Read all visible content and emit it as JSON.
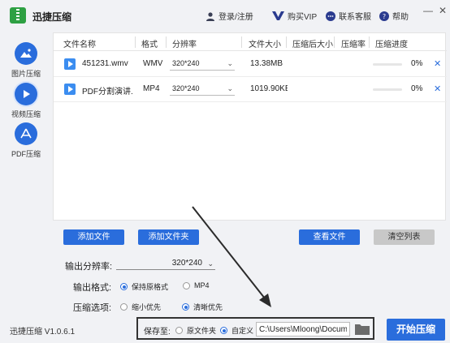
{
  "app": {
    "title": "迅捷压缩",
    "version": "迅捷压缩 V1.0.6.1"
  },
  "titlebar": {
    "login": "登录/注册",
    "vip": "购买VIP",
    "service": "联系客服",
    "help": "帮助",
    "min": "—",
    "close": "✕"
  },
  "sidebar": {
    "items": [
      {
        "label": "图片压缩",
        "icon": "image-icon"
      },
      {
        "label": "视频压缩",
        "icon": "play-icon"
      },
      {
        "label": "PDF压缩",
        "icon": "pdf-icon"
      }
    ]
  },
  "table": {
    "headers": [
      "文件名称",
      "格式",
      "分辨率",
      "文件大小",
      "压缩后大小",
      "压缩率",
      "压缩进度"
    ],
    "rows": [
      {
        "name": "451231.wmv",
        "format": "WMV",
        "resolution": "320*240",
        "size": "13.38MB",
        "after": "",
        "ratio": "",
        "progress": 0,
        "progress_text": "0%"
      },
      {
        "name": "PDF分割演讲...",
        "format": "MP4",
        "resolution": "320*240",
        "size": "1019.90KE",
        "after": "",
        "ratio": "",
        "progress": 0,
        "progress_text": "0%"
      }
    ]
  },
  "actions": {
    "add_file": "添加文件",
    "add_folder": "添加文件夹",
    "view_file": "查看文件",
    "clear_list": "清空列表"
  },
  "options": {
    "resolution_label": "输出分辨率:",
    "resolution_value": "320*240",
    "format_label": "输出格式:",
    "format_keep": "保持原格式",
    "format_mp4": "MP4",
    "format_selected": "keep",
    "compress_label": "压缩选项:",
    "compress_small": "缩小优先",
    "compress_clear": "清晰优先",
    "compress_selected": "clear"
  },
  "save": {
    "label": "保存至:",
    "original": "原文件夹",
    "custom": "自定义",
    "selected": "custom",
    "path": "C:\\Users\\Mloong\\Documents"
  },
  "start_button": "开始压缩",
  "colors": {
    "accent": "#2a6ddc",
    "disabled": "#c8c8c8",
    "background": "#f1f2f5"
  }
}
